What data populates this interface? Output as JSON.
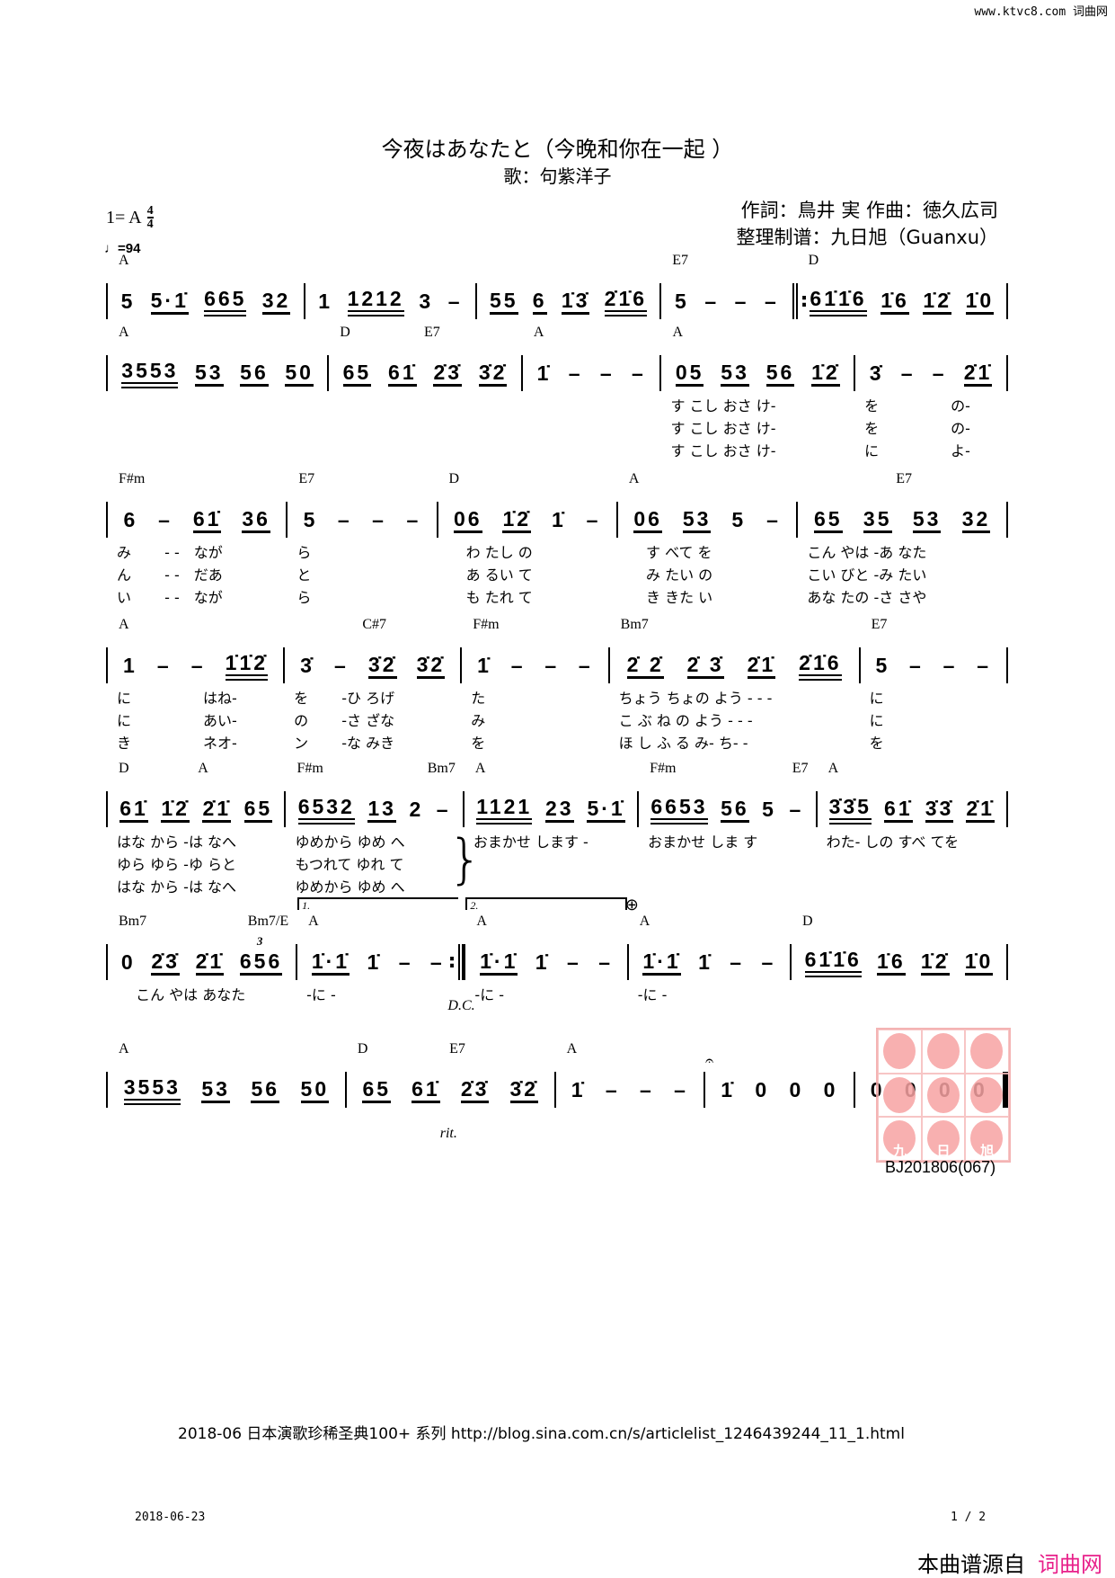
{
  "site_mark": "www.ktvc8.com 词曲网",
  "title": "今夜はあなたと（今晚和你在一起 ）",
  "subtitle": "歌：句紫洋子",
  "key": {
    "label": "1= A",
    "time_top": "4",
    "time_bottom": "4"
  },
  "tempo": "♩=94",
  "credits": [
    "作詞：鳥井 実 作曲：徳久広司",
    "整理制谱：九日旭（Guanxu）"
  ],
  "systems": [
    {
      "measures": [
        {
          "chords": [
            "A"
          ],
          "groups": [
            {
              "t": "5"
            },
            {
              "t": "5·1̇",
              "b": 1
            },
            {
              "t": "665",
              "b": 2
            },
            {
              "t": "32",
              "b": 1
            }
          ]
        },
        {
          "chords": [],
          "groups": [
            {
              "t": "1"
            },
            {
              "t": "1212",
              "b": 2
            },
            {
              "t": "3"
            },
            {
              "t": "–"
            }
          ]
        },
        {
          "chords": [],
          "groups": [
            {
              "t": "55",
              "b": 1
            },
            {
              "t": "6",
              "b": 1
            },
            {
              "t": "1̇3̇",
              "b": 1
            },
            {
              "t": "2̇1̇6",
              "b": 2
            }
          ]
        },
        {
          "chords": [
            "E7"
          ],
          "groups": [
            {
              "t": "5"
            },
            {
              "t": "–"
            },
            {
              "t": "–"
            },
            {
              "t": "–"
            }
          ]
        },
        {
          "chords": [
            "D"
          ],
          "bar": "repeat-start",
          "groups": [
            {
              "t": "61̇1̇6",
              "b": 2
            },
            {
              "t": "1̇6",
              "b": 1
            },
            {
              "t": "1̇2̇",
              "b": 1
            },
            {
              "t": "1̇0",
              "b": 1
            }
          ]
        }
      ]
    },
    {
      "measures": [
        {
          "chords": [
            "A"
          ],
          "groups": [
            {
              "t": "3553",
              "b": 2
            },
            {
              "t": "53",
              "b": 1
            },
            {
              "t": "56",
              "b": 1
            },
            {
              "t": "50",
              "b": 1
            }
          ]
        },
        {
          "chords": [
            "D",
            "E7",
            ""
          ],
          "groups": [
            {
              "t": "65",
              "b": 1
            },
            {
              "t": "61̇",
              "b": 1
            },
            {
              "t": "2̇3̇",
              "b": 1
            },
            {
              "t": "3̇2̇",
              "b": 1
            }
          ]
        },
        {
          "chords": [
            "A"
          ],
          "groups": [
            {
              "t": "1̇"
            },
            {
              "t": "–"
            },
            {
              "t": "–"
            },
            {
              "t": "–"
            }
          ]
        },
        {
          "chords": [
            "A"
          ],
          "groups": [
            {
              "t": "05",
              "b": 1
            },
            {
              "t": "53",
              "b": 1
            },
            {
              "t": "56",
              "b": 1
            },
            {
              "t": "1̇2̇",
              "b": 1
            }
          ],
          "lyrics": [
            "す こし おさ け-",
            "す こし おさ け-",
            "す こし おさ け-"
          ]
        },
        {
          "chords": [],
          "groups": [
            {
              "t": "3̇"
            },
            {
              "t": "–"
            },
            {
              "t": "–"
            },
            {
              "t": "2̇1̇",
              "b": 1
            }
          ],
          "lyrics": [
            "を　　　　　の-",
            "を　　　　　の-",
            "に　　　　　よ-"
          ]
        }
      ]
    },
    {
      "measures": [
        {
          "chords": [
            "F#m"
          ],
          "groups": [
            {
              "t": "6"
            },
            {
              "t": "–"
            },
            {
              "t": "61̇",
              "b": 1
            },
            {
              "t": "36",
              "b": 1
            }
          ],
          "lyrics": [
            "み　　 - -　なが",
            "ん　　 - -　だあ",
            "い　　 - -　なが"
          ]
        },
        {
          "chords": [
            "E7"
          ],
          "groups": [
            {
              "t": "5"
            },
            {
              "t": "–"
            },
            {
              "t": "–"
            },
            {
              "t": "–"
            }
          ],
          "lyrics": [
            "ら",
            "と",
            "ら"
          ]
        },
        {
          "chords": [
            "D"
          ],
          "groups": [
            {
              "t": "06",
              "b": 1
            },
            {
              "t": "1̇2̇",
              "b": 1
            },
            {
              "t": "1̇"
            },
            {
              "t": "–"
            }
          ],
          "lyrics": [
            "　 わ たし の",
            "　 あ るい て",
            "　 も たれ て"
          ]
        },
        {
          "chords": [
            "A"
          ],
          "groups": [
            {
              "t": "06",
              "b": 1
            },
            {
              "t": "53",
              "b": 1
            },
            {
              "t": "5"
            },
            {
              "t": "–"
            }
          ],
          "lyrics": [
            "　 す べて を",
            "　 み たい の",
            "　 き きた い"
          ]
        },
        {
          "chords": [
            "",
            "E7",
            ""
          ],
          "groups": [
            {
              "t": "65",
              "b": 1
            },
            {
              "t": "35",
              "b": 1
            },
            {
              "t": "53",
              "b": 1
            },
            {
              "t": "32",
              "b": 1
            }
          ],
          "lyrics": [
            "こん やは -あ なた",
            "こい びと -み たい",
            "あな たの -さ さや"
          ]
        }
      ]
    },
    {
      "measures": [
        {
          "chords": [
            "A"
          ],
          "groups": [
            {
              "t": "1"
            },
            {
              "t": "–"
            },
            {
              "t": "–"
            },
            {
              "t": "1̇1̇2̇",
              "b": 2
            }
          ],
          "lyrics": [
            "に　　　　　はね-",
            "に　　　　　あい-",
            "き　　　　　ネオ-"
          ]
        },
        {
          "chords": [
            "",
            "C#7",
            ""
          ],
          "groups": [
            {
              "t": "3̇"
            },
            {
              "t": "–"
            },
            {
              "t": "3̇2̇",
              "b": 1
            },
            {
              "t": "3̇2̇",
              "b": 1
            }
          ],
          "lyrics": [
            "を　　 -ひ ろげ",
            "の　　 -さ ざな",
            "ン　　 -な みき"
          ]
        },
        {
          "chords": [
            "F#m"
          ],
          "groups": [
            {
              "t": "1̇"
            },
            {
              "t": "–"
            },
            {
              "t": "–"
            },
            {
              "t": "–"
            }
          ],
          "lyrics": [
            "た",
            "み",
            "を"
          ]
        },
        {
          "chords": [
            "Bm7"
          ],
          "groups": [
            {
              "t": "2̇ 2̇",
              "b": 1
            },
            {
              "t": "2̇ 3̇",
              "b": 1
            },
            {
              "t": "2̇1̇",
              "b": 1
            },
            {
              "t": "2̇1̇6",
              "b": 2
            }
          ],
          "lyrics": [
            "ちょう ちょの よう - - -",
            "こ ぶ ね の よう - - -",
            "ほ し ふ る み- ち- -"
          ]
        },
        {
          "chords": [
            "E7"
          ],
          "groups": [
            {
              "t": "5"
            },
            {
              "t": "–"
            },
            {
              "t": "–"
            },
            {
              "t": "–"
            }
          ],
          "lyrics": [
            "に",
            "に",
            "を"
          ]
        }
      ]
    },
    {
      "measures": [
        {
          "chords": [
            "D",
            "A",
            ""
          ],
          "groups": [
            {
              "t": "61̇",
              "b": 1
            },
            {
              "t": "1̇2̇",
              "b": 1
            },
            {
              "t": "2̇1̇",
              "b": 1
            },
            {
              "t": "65",
              "b": 1
            }
          ],
          "lyrics": [
            "はな から -は なへ",
            "ゆら ゆら -ゆ らと",
            "はな から -は なへ"
          ]
        },
        {
          "chords": [
            "F#m",
            "Bm7"
          ],
          "brace": "}",
          "groups": [
            {
              "t": "6532",
              "b": 2
            },
            {
              "t": "13",
              "b": 1
            },
            {
              "t": "2"
            },
            {
              "t": "–"
            }
          ],
          "lyrics": [
            "ゆめから ゆめ へ",
            "もつれて ゆれ て",
            "ゆめから ゆめ へ"
          ]
        },
        {
          "chords": [
            "A"
          ],
          "groups": [
            {
              "t": "1121",
              "b": 2
            },
            {
              "t": "23",
              "b": 1
            },
            {
              "t": "5·1̇",
              "b": 1
            }
          ],
          "lyrics": [
            "おまかせ します -"
          ]
        },
        {
          "chords": [
            "F#m",
            "E7"
          ],
          "groups": [
            {
              "t": "6653",
              "b": 2
            },
            {
              "t": "56",
              "b": 1
            },
            {
              "t": "5"
            },
            {
              "t": "–"
            }
          ],
          "lyrics": [
            "おまかせ しま す"
          ]
        },
        {
          "chords": [
            "A"
          ],
          "groups": [
            {
              "t": "3̇3̇5",
              "b": 2
            },
            {
              "t": "61̇",
              "b": 1
            },
            {
              "t": "3̇3̇",
              "b": 1
            },
            {
              "t": "2̇1̇",
              "b": 1
            }
          ],
          "lyrics": [
            "わた- しの すべ てを"
          ]
        }
      ]
    },
    {
      "measures": [
        {
          "chords": [
            "Bm7",
            "Bm7/E"
          ],
          "groups": [
            {
              "t": "0"
            },
            {
              "t": "2̇3̇",
              "b": 1
            },
            {
              "t": "2̇1̇",
              "b": 1
            },
            {
              "t": "656",
              "b": 1,
              "tuplet": "3"
            }
          ],
          "lyrics": [
            "　 こん やは あなた"
          ]
        },
        {
          "chords": [
            "A"
          ],
          "volta": "1.",
          "bar": "repeat-end",
          "groups": [
            {
              "t": "1̇·1̇",
              "b": 1
            },
            {
              "t": "1̇"
            },
            {
              "t": "–"
            },
            {
              "t": "–"
            }
          ],
          "lyrics": [
            "-に -"
          ]
        },
        {
          "chords": [
            "A"
          ],
          "volta": "2.",
          "volta_closed": true,
          "below": "D.C.",
          "groups": [
            {
              "t": "1̇·1̇",
              "b": 1
            },
            {
              "t": "1̇"
            },
            {
              "t": "–"
            },
            {
              "t": "–"
            }
          ],
          "lyrics": [
            "-に -"
          ]
        },
        {
          "chords": [
            "A"
          ],
          "coda": "⊕",
          "groups": [
            {
              "t": "1̇·1̇",
              "b": 1
            },
            {
              "t": "1̇"
            },
            {
              "t": "–"
            },
            {
              "t": "–"
            }
          ],
          "lyrics": [
            "-に -"
          ]
        },
        {
          "chords": [
            "D"
          ],
          "groups": [
            {
              "t": "61̇1̇6",
              "b": 2
            },
            {
              "t": "1̇6",
              "b": 1
            },
            {
              "t": "1̇2̇",
              "b": 1
            },
            {
              "t": "1̇0",
              "b": 1
            }
          ]
        }
      ]
    },
    {
      "measures": [
        {
          "chords": [
            "A"
          ],
          "groups": [
            {
              "t": "3553",
              "b": 2
            },
            {
              "t": "53",
              "b": 1
            },
            {
              "t": "56",
              "b": 1
            },
            {
              "t": "50",
              "b": 1
            }
          ]
        },
        {
          "chords": [
            "D",
            "E7",
            ""
          ],
          "below": "rit.",
          "groups": [
            {
              "t": "65",
              "b": 1
            },
            {
              "t": "61̇",
              "b": 1
            },
            {
              "t": "2̇3̇",
              "b": 1
            },
            {
              "t": "3̇2̇",
              "b": 1
            }
          ]
        },
        {
          "chords": [
            "A"
          ],
          "groups": [
            {
              "t": "1̇"
            },
            {
              "t": "–"
            },
            {
              "t": "–"
            },
            {
              "t": "–"
            }
          ]
        },
        {
          "chords": [],
          "fermata": "𝄐",
          "groups": [
            {
              "t": "1̇"
            },
            {
              "t": "0"
            },
            {
              "t": "0"
            },
            {
              "t": "0"
            }
          ]
        },
        {
          "chords": [],
          "bar": "final",
          "groups": [
            {
              "t": "0"
            },
            {
              "t": "0"
            },
            {
              "t": "0"
            },
            {
              "t": "0"
            }
          ]
        }
      ]
    }
  ],
  "stamp": {
    "chars": [
      "九",
      "日",
      "旭"
    ],
    "color": "#f7a3a3"
  },
  "score_code": "BJ201806(067)",
  "footer": {
    "series": "2018-06 日本演歌珍稀圣典100+ 系列  http://blog.sina.com.cn/s/articlelist_1246439244_11_1.html",
    "date": "2018-06-23",
    "page": "1 / 2",
    "source_prefix": "本曲谱源自",
    "source_site": "词曲网",
    "source_color": "#e8208a"
  }
}
